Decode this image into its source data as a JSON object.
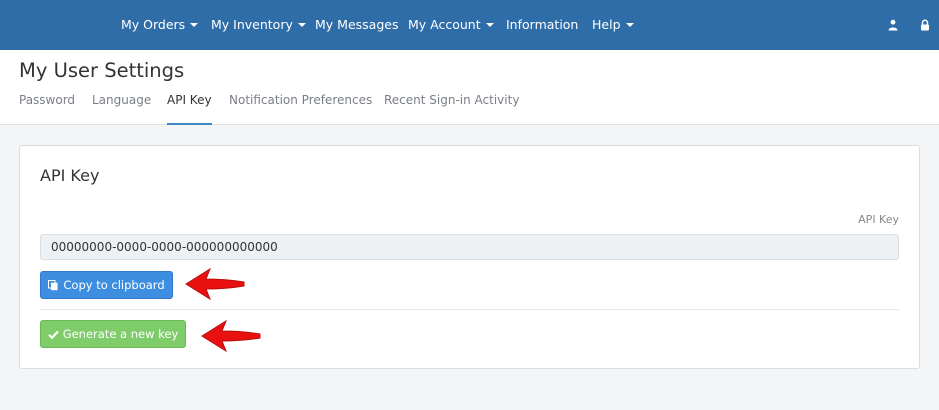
{
  "nav": {
    "items": [
      {
        "label": "My Orders",
        "dropdown": true
      },
      {
        "label": "My Inventory",
        "dropdown": true
      },
      {
        "label": "My Messages",
        "dropdown": false
      },
      {
        "label": "My Account",
        "dropdown": true
      },
      {
        "label": "Information",
        "dropdown": false
      },
      {
        "label": "Help",
        "dropdown": true
      }
    ],
    "icons": [
      "user-icon",
      "lock-icon"
    ],
    "background": "#2f6da8"
  },
  "header": {
    "title": "My User Settings",
    "tabs": [
      {
        "label": "Password",
        "active": false
      },
      {
        "label": "Language",
        "active": false
      },
      {
        "label": "API Key",
        "active": true
      },
      {
        "label": "Notification Preferences",
        "active": false
      },
      {
        "label": "Recent Sign-in Activity",
        "active": false
      }
    ]
  },
  "api_card": {
    "title": "API Key",
    "field_label": "API Key",
    "key_value": "00000000-0000-0000-000000000000",
    "copy_button": {
      "label": "Copy to clipboard",
      "icon": "copy-icon",
      "color": "#3d8ee0"
    },
    "generate_button": {
      "label": "Generate a new key",
      "icon": "check-icon",
      "color": "#7fcc6a"
    }
  },
  "annotations": {
    "arrow_color": "#e8110f"
  }
}
